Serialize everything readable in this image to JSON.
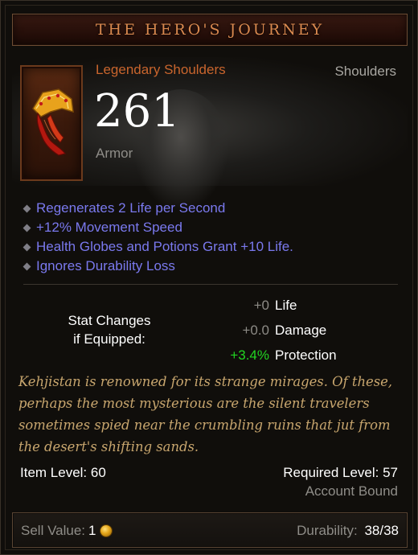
{
  "tooltip": {
    "title": "THE HERO'S JOURNEY",
    "item_type": "Legendary Shoulders",
    "slot": "Shoulders",
    "armor": {
      "value": "261",
      "label": "Armor"
    },
    "affixes": [
      "Regenerates 2 Life per Second",
      "+12% Movement Speed",
      "Health Globes and Potions Grant +10 Life.",
      "Ignores Durability Loss"
    ],
    "stat_changes": {
      "heading_line1": "Stat Changes",
      "heading_line2": "if Equipped:",
      "rows": [
        {
          "value": "+0",
          "name": "Life"
        },
        {
          "value": "+0.0",
          "name": "Damage"
        },
        {
          "value": "+3.4%",
          "name": "Protection"
        }
      ]
    },
    "flavor_text": "Kehjistan is renowned for its strange mirages. Of these, perhaps the most mysterious are the silent travelers sometimes spied near the crumbling ruins that jut from the desert's shifting sands.",
    "item_level_label": "Item Level: 60",
    "required_level_label": "Required Level: 57",
    "binding": "Account Bound",
    "footer": {
      "sell_label": "Sell Value:",
      "sell_amount": "1",
      "durability_label": "Durability:",
      "durability_value": "38/38"
    }
  },
  "icons": {
    "item": "legendary-shoulders-icon",
    "gold": "gold-coin-icon",
    "bullet": "diamond-bullet-icon"
  },
  "colors": {
    "legendary": "#c9652d",
    "magic_affix": "#7a79ee",
    "stat_positive": "#22d422",
    "flavor": "#c8a66e",
    "title": "#d9894f"
  }
}
